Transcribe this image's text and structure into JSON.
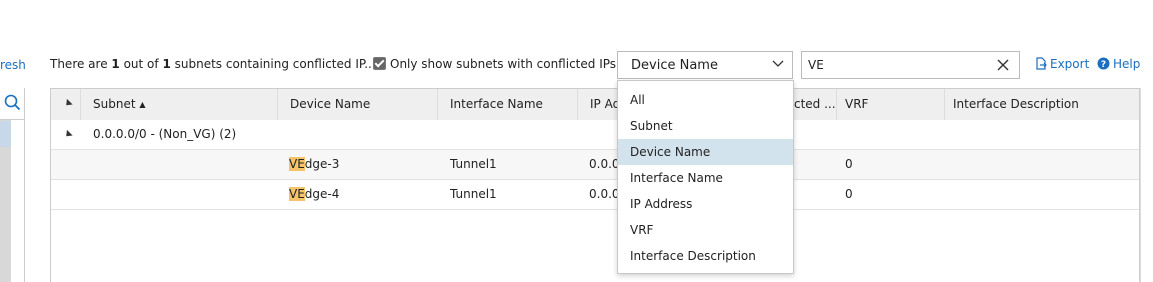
{
  "toolbar": {
    "refresh_label": "resh",
    "summary_prefix": "There are ",
    "summary_count": "1",
    "summary_mid": " out of ",
    "summary_total": "1",
    "summary_suffix": " subnets containing conflicted IP...",
    "only_conflicted_label": "Only show subnets with conflicted IPs",
    "only_conflicted_checked": true,
    "filter_field_value": "Device Name",
    "search_value": "VE",
    "export_label": "Export",
    "help_label": "Help"
  },
  "grid": {
    "columns": [
      "Subnet",
      "Device Name",
      "Interface Name",
      "IP Ad",
      "cted ...",
      "VRF",
      "Interface Description"
    ],
    "group_row": {
      "label": "0.0.0.0/0 - (Non_VG) (2)"
    },
    "rows": [
      {
        "device_highlight": "VE",
        "device_rest": "dge-3",
        "interface": "Tunnel1",
        "ip": "0.0.0",
        "vrf": "0"
      },
      {
        "device_highlight": "VE",
        "device_rest": "dge-4",
        "interface": "Tunnel1",
        "ip": "0.0.0",
        "vrf": "0"
      }
    ]
  },
  "dropdown": {
    "options": [
      "All",
      "Subnet",
      "Device Name",
      "Interface Name",
      "IP Address",
      "VRF",
      "Interface Description"
    ],
    "selected": "Device Name"
  },
  "colors": {
    "accent": "#1a6fc0",
    "highlight": "#f5c36a",
    "selected_option": "#d3e3ee"
  }
}
